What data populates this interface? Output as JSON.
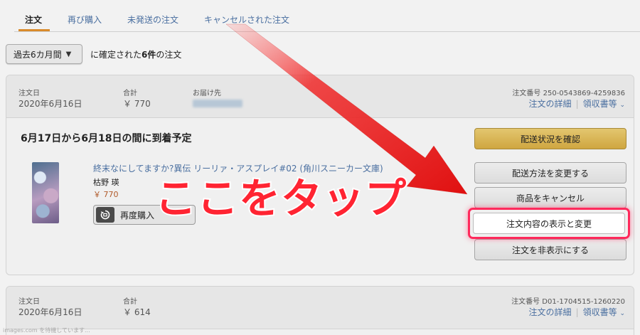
{
  "tabs": [
    {
      "label": "注文",
      "active": true
    },
    {
      "label": "再び購入",
      "active": false
    },
    {
      "label": "未発送の注文",
      "active": false
    },
    {
      "label": "キャンセルされた注文",
      "active": false
    }
  ],
  "filter": {
    "period_label": "過去6カ月間",
    "prefix": "に確定された",
    "count": "6件",
    "suffix": "の注文"
  },
  "orders": [
    {
      "header": {
        "order_date_label": "注文日",
        "order_date": "2020年6月16日",
        "total_label": "合計",
        "total": "￥ 770",
        "ship_to_label": "お届け先",
        "order_number_label": "注文番号",
        "order_number": "250-0543869-4259836",
        "details_link": "注文の詳細",
        "receipt_link": "領収書等"
      },
      "delivery_status": "6月17日から6月18日の間に到着予定",
      "item": {
        "title": "終末なにしてますか?異伝 リーリァ・アスプレイ#02 (角川スニーカー文庫)",
        "author": "枯野 瑛",
        "price": "￥ 770",
        "rebuy_label": "再度購入"
      },
      "actions": [
        "配送状況を確認",
        "配送方法を変更する",
        "商品をキャンセル",
        "注文内容の表示と変更",
        "注文を非表示にする"
      ]
    },
    {
      "header": {
        "order_date_label": "注文日",
        "order_date": "2020年6月16日",
        "total_label": "合計",
        "total": "￥ 614",
        "order_number_label": "注文番号",
        "order_number": "D01-1704515-1260220",
        "details_link": "注文の詳細",
        "receipt_link": "領収書等"
      }
    }
  ],
  "overlay": {
    "caption": "ここをタップ",
    "caption_color": "#ff2432",
    "arrow_color": "#f01d26",
    "highlight_color": "#ff2a5c"
  },
  "status_bar": "images.com を待機しています..."
}
